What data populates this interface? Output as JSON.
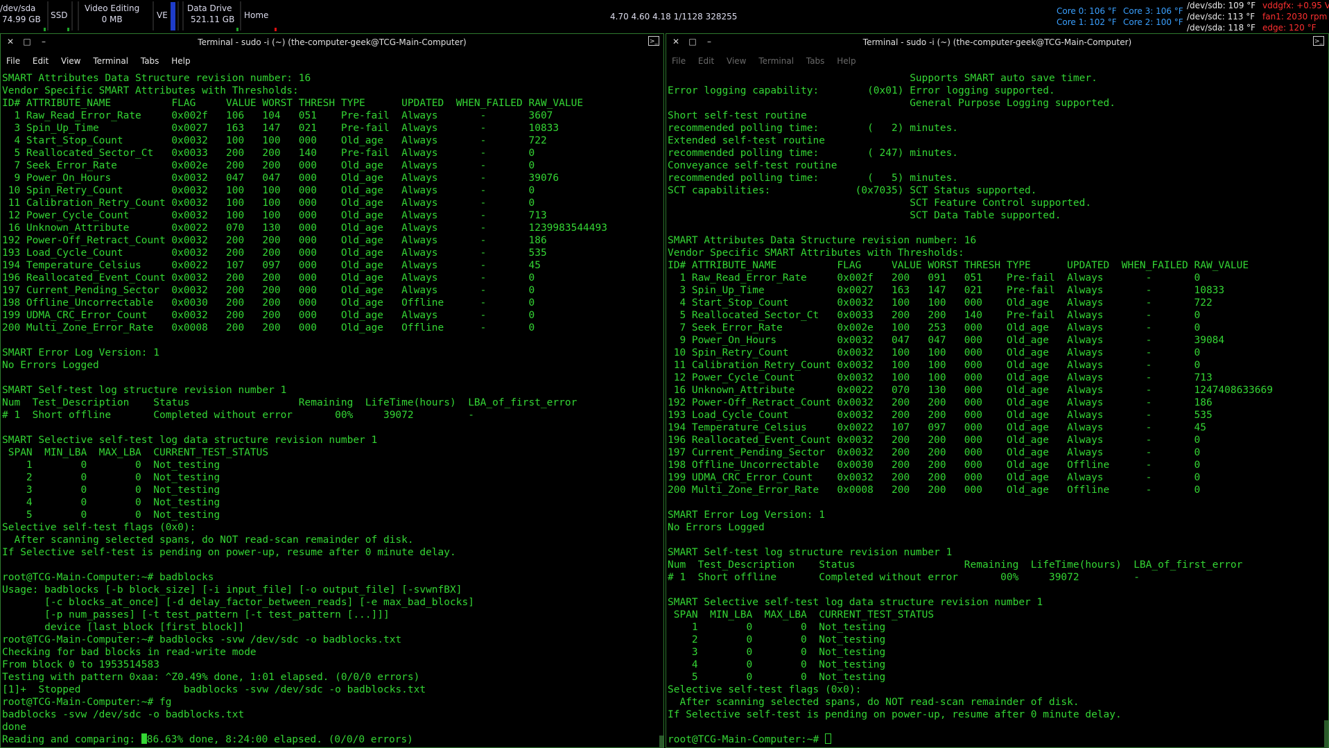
{
  "panel": {
    "dev_sda_label": "/dev/sda",
    "dev_sda_size": "74.99 GB",
    "ssd_label": "SSD",
    "video_label": "Video Editing",
    "video_size": "0 MB",
    "ve_label": "VE",
    "data_label": "Data Drive",
    "data_size": "521.11 GB",
    "home_label": "Home",
    "load": "4.70 4.60 4.18 1/1128 328255",
    "core0": "Core 0: 106 °F",
    "core1": "Core 1: 102 °F",
    "core3": "Core 3: 106 °F",
    "core2": "Core 2: 100 °F",
    "sdb": "/dev/sdb: 109 °F",
    "sdc": "/dev/sdc: 113 °F",
    "sda": "/dev/sda: 118 °F",
    "vddgfx": "vddgfx: +0.95 V",
    "fan1": "fan1: 2030 rpm",
    "edge": "edge: 120 °F"
  },
  "colors": {
    "terminal_text": "#34d634",
    "border": "#2f7a2f",
    "panel_blue": "#3aa0ff",
    "panel_red": "#ff3030"
  },
  "left_window": {
    "title": "Terminal - sudo -i (~) (the-computer-geek@TCG-Main-Computer)",
    "menu": [
      "File",
      "Edit",
      "View",
      "Terminal",
      "Tabs",
      "Help"
    ],
    "text": "SMART Attributes Data Structure revision number: 16\nVendor Specific SMART Attributes with Thresholds:\nID# ATTRIBUTE_NAME          FLAG     VALUE WORST THRESH TYPE      UPDATED  WHEN_FAILED RAW_VALUE\n  1 Raw_Read_Error_Rate     0x002f   106   104   051    Pre-fail  Always       -       3607\n  3 Spin_Up_Time            0x0027   163   147   021    Pre-fail  Always       -       10833\n  4 Start_Stop_Count        0x0032   100   100   000    Old_age   Always       -       722\n  5 Reallocated_Sector_Ct   0x0033   200   200   140    Pre-fail  Always       -       0\n  7 Seek_Error_Rate         0x002e   200   200   000    Old_age   Always       -       0\n  9 Power_On_Hours          0x0032   047   047   000    Old_age   Always       -       39076\n 10 Spin_Retry_Count        0x0032   100   100   000    Old_age   Always       -       0\n 11 Calibration_Retry_Count 0x0032   100   100   000    Old_age   Always       -       0\n 12 Power_Cycle_Count       0x0032   100   100   000    Old_age   Always       -       713\n 16 Unknown_Attribute       0x0022   070   130   000    Old_age   Always       -       1239983544493\n192 Power-Off_Retract_Count 0x0032   200   200   000    Old_age   Always       -       186\n193 Load_Cycle_Count        0x0032   200   200   000    Old_age   Always       -       535\n194 Temperature_Celsius     0x0022   107   097   000    Old_age   Always       -       45\n196 Reallocated_Event_Count 0x0032   200   200   000    Old_age   Always       -       0\n197 Current_Pending_Sector  0x0032   200   200   000    Old_age   Always       -       0\n198 Offline_Uncorrectable   0x0030   200   200   000    Old_age   Offline      -       0\n199 UDMA_CRC_Error_Count    0x0032   200   200   000    Old_age   Always       -       0\n200 Multi_Zone_Error_Rate   0x0008   200   200   000    Old_age   Offline      -       0\n\nSMART Error Log Version: 1\nNo Errors Logged\n\nSMART Self-test log structure revision number 1\nNum  Test_Description    Status                  Remaining  LifeTime(hours)  LBA_of_first_error\n# 1  Short offline       Completed without error       00%     39072         -\n\nSMART Selective self-test log data structure revision number 1\n SPAN  MIN_LBA  MAX_LBA  CURRENT_TEST_STATUS\n    1        0        0  Not_testing\n    2        0        0  Not_testing\n    3        0        0  Not_testing\n    4        0        0  Not_testing\n    5        0        0  Not_testing\nSelective self-test flags (0x0):\n  After scanning selected spans, do NOT read-scan remainder of disk.\nIf Selective self-test is pending on power-up, resume after 0 minute delay.\n\nroot@TCG-Main-Computer:~# badblocks\nUsage: badblocks [-b block_size] [-i input_file] [-o output_file] [-svwnfBX]\n       [-c blocks_at_once] [-d delay_factor_between_reads] [-e max_bad_blocks]\n       [-p num_passes] [-t test_pattern [-t test_pattern [...]]]\n       device [last_block [first_block]]\nroot@TCG-Main-Computer:~# badblocks -svw /dev/sdc -o badblocks.txt\nChecking for bad blocks in read-write mode\nFrom block 0 to 1953514583\nTesting with pattern 0xaa: ^Z0.49% done, 1:01 elapsed. (0/0/0 errors)\n[1]+  Stopped                 badblocks -svw /dev/sdc -o badblocks.txt\nroot@TCG-Main-Computer:~# fg\nbadblocks -svw /dev/sdc -o badblocks.txt\ndone\nReading and comparing: ",
    "last_line_tail": "86.63% done, 8:24:00 elapsed. (0/0/0 errors)"
  },
  "right_window": {
    "title": "Terminal - sudo -i (~) (the-computer-geek@TCG-Main-Computer)",
    "menu": [
      "File",
      "Edit",
      "View",
      "Terminal",
      "Tabs",
      "Help"
    ],
    "text": "                                        Supports SMART auto save timer.\nError logging capability:        (0x01) Error logging supported.\n                                        General Purpose Logging supported.\nShort self-test routine\nrecommended polling time:        (   2) minutes.\nExtended self-test routine\nrecommended polling time:        ( 247) minutes.\nConveyance self-test routine\nrecommended polling time:        (   5) minutes.\nSCT capabilities:              (0x7035) SCT Status supported.\n                                        SCT Feature Control supported.\n                                        SCT Data Table supported.\n\nSMART Attributes Data Structure revision number: 16\nVendor Specific SMART Attributes with Thresholds:\nID# ATTRIBUTE_NAME          FLAG     VALUE WORST THRESH TYPE      UPDATED  WHEN_FAILED RAW_VALUE\n  1 Raw_Read_Error_Rate     0x002f   200   091   051    Pre-fail  Always       -       0\n  3 Spin_Up_Time            0x0027   163   147   021    Pre-fail  Always       -       10833\n  4 Start_Stop_Count        0x0032   100   100   000    Old_age   Always       -       722\n  5 Reallocated_Sector_Ct   0x0033   200   200   140    Pre-fail  Always       -       0\n  7 Seek_Error_Rate         0x002e   100   253   000    Old_age   Always       -       0\n  9 Power_On_Hours          0x0032   047   047   000    Old_age   Always       -       39084\n 10 Spin_Retry_Count        0x0032   100   100   000    Old_age   Always       -       0\n 11 Calibration_Retry_Count 0x0032   100   100   000    Old_age   Always       -       0\n 12 Power_Cycle_Count       0x0032   100   100   000    Old_age   Always       -       713\n 16 Unknown_Attribute       0x0022   070   130   000    Old_age   Always       -       1247408633669\n192 Power-Off_Retract_Count 0x0032   200   200   000    Old_age   Always       -       186\n193 Load_Cycle_Count        0x0032   200   200   000    Old_age   Always       -       535\n194 Temperature_Celsius     0x0022   107   097   000    Old_age   Always       -       45\n196 Reallocated_Event_Count 0x0032   200   200   000    Old_age   Always       -       0\n197 Current_Pending_Sector  0x0032   200   200   000    Old_age   Always       -       0\n198 Offline_Uncorrectable   0x0030   200   200   000    Old_age   Offline      -       0\n199 UDMA_CRC_Error_Count    0x0032   200   200   000    Old_age   Always       -       0\n200 Multi_Zone_Error_Rate   0x0008   200   200   000    Old_age   Offline      -       0\n\nSMART Error Log Version: 1\nNo Errors Logged\n\nSMART Self-test log structure revision number 1\nNum  Test_Description    Status                  Remaining  LifeTime(hours)  LBA_of_first_error\n# 1  Short offline       Completed without error       00%     39072         -\n\nSMART Selective self-test log data structure revision number 1\n SPAN  MIN_LBA  MAX_LBA  CURRENT_TEST_STATUS\n    1        0        0  Not_testing\n    2        0        0  Not_testing\n    3        0        0  Not_testing\n    4        0        0  Not_testing\n    5        0        0  Not_testing\nSelective self-test flags (0x0):\n  After scanning selected spans, do NOT read-scan remainder of disk.\nIf Selective self-test is pending on power-up, resume after 0 minute delay.\n\nroot@TCG-Main-Computer:~# "
  }
}
